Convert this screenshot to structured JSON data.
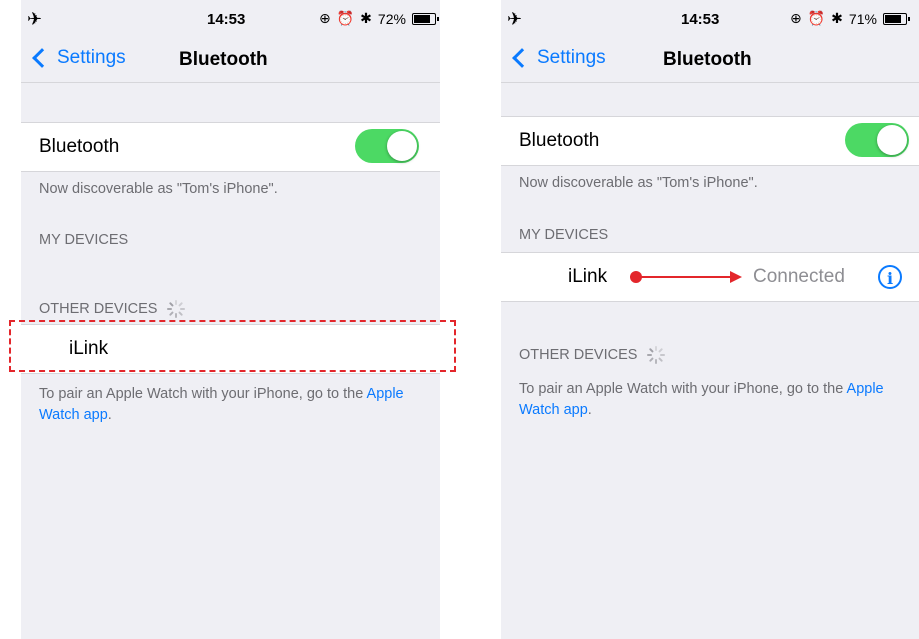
{
  "left_screen": {
    "status": {
      "time": "14:53",
      "battery": "72%",
      "airplane_icon": "airplane-icon"
    },
    "nav": {
      "back_label": "Settings",
      "title": "Bluetooth"
    },
    "bluetooth_row": {
      "label": "Bluetooth",
      "toggle_on": true
    },
    "discoverable": "Now discoverable as \"Tom's iPhone\".",
    "my_devices_header": "MY DEVICES",
    "other_devices_header": "OTHER DEVICES",
    "other_devices": [
      {
        "name": "iLink"
      }
    ],
    "pair_text": "To pair an Apple Watch with your iPhone, go to the ",
    "pair_link": "Apple Watch app",
    "pair_end": "."
  },
  "right_screen": {
    "status": {
      "time": "14:53",
      "battery": "71%",
      "airplane_icon": "airplane-icon"
    },
    "nav": {
      "back_label": "Settings",
      "title": "Bluetooth"
    },
    "bluetooth_row": {
      "label": "Bluetooth",
      "toggle_on": true
    },
    "discoverable": "Now discoverable as \"Tom's iPhone\".",
    "my_devices_header": "MY DEVICES",
    "my_devices": [
      {
        "name": "iLink",
        "status": "Connected"
      }
    ],
    "other_devices_header": "OTHER DEVICES",
    "pair_text": "To pair an Apple Watch with your iPhone, go to the ",
    "pair_link": "Apple Watch app",
    "pair_end": "."
  },
  "colors": {
    "accent": "#0a7aff",
    "toggle_on": "#4cd964",
    "annotation": "#e3262b",
    "background": "#efeff4"
  }
}
